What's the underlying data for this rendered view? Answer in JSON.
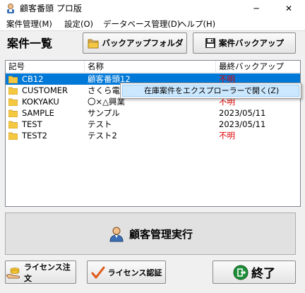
{
  "window": {
    "title": "顧客番頭 プロ版",
    "minimize_glyph": "─",
    "close_glyph": "✕"
  },
  "menu": [
    {
      "label": "案件管理(M)"
    },
    {
      "label": "設定(O)"
    },
    {
      "label": "データベース管理(D)"
    },
    {
      "label": "ヘルプ(H)"
    }
  ],
  "header": {
    "title": "案件一覧",
    "backup_folder_label": "バックアップフォルダ",
    "backup_case_label": "案件バックアップ"
  },
  "list": {
    "columns": [
      "記号",
      "名称",
      "最終バックアップ"
    ],
    "rows": [
      {
        "code": "CB12",
        "name": "顧客番頭12",
        "last_backup": "不明",
        "selected": true
      },
      {
        "code": "CUSTOMER",
        "name": "さくら電機",
        "last_backup": "",
        "selected": false
      },
      {
        "code": "KOKYAKU",
        "name": "〇×△興業",
        "last_backup": "不明",
        "selected": false
      },
      {
        "code": "SAMPLE",
        "name": "サンプル",
        "last_backup": "2023/05/11",
        "selected": false
      },
      {
        "code": "TEST",
        "name": "テスト",
        "last_backup": "2023/05/11",
        "selected": false
      },
      {
        "code": "TEST2",
        "name": "テスト2",
        "last_backup": "不明",
        "selected": false
      }
    ]
  },
  "context_menu": {
    "item_label": "在庫案件をエクスプローラーで開く(Z)"
  },
  "main_button": {
    "label": "顧客管理実行"
  },
  "footer": {
    "license_order_label": "ライセンス注文",
    "license_auth_label": "ライセンス認証",
    "exit_label": "終了"
  },
  "colors": {
    "selection": "#0078d7",
    "unknown_text": "#e00000",
    "folder": "#f5c842",
    "context_highlight": "#cce8ff"
  },
  "icons": [
    "app-icon",
    "folder-icon",
    "floppy-disk-icon",
    "user-icon",
    "hand-coins-icon",
    "checkmark-icon",
    "exit-icon"
  ]
}
